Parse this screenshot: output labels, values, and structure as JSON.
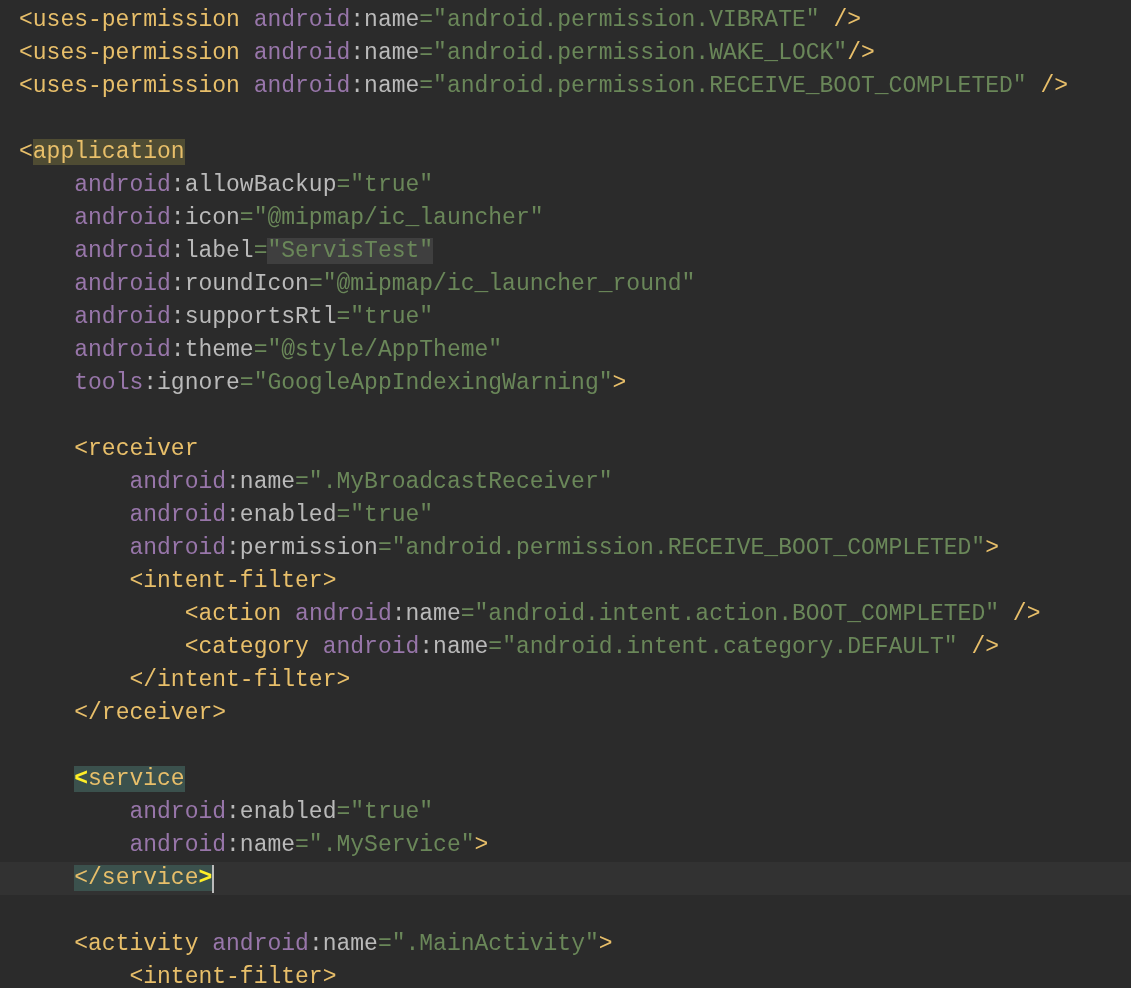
{
  "editor": {
    "lines": [
      {
        "kind": "code",
        "tokens": [
          {
            "kind": "tag",
            "text": "<uses-permission"
          },
          {
            "kind": "ns",
            "text": " android"
          },
          {
            "kind": "attr",
            "text": ":name"
          },
          {
            "kind": "value",
            "text": "=\"android.permission.VIBRATE\""
          },
          {
            "kind": "tag",
            "text": " />"
          }
        ]
      },
      {
        "kind": "code",
        "tokens": [
          {
            "kind": "tag",
            "text": "<uses-permission"
          },
          {
            "kind": "ns",
            "text": " android"
          },
          {
            "kind": "attr",
            "text": ":name"
          },
          {
            "kind": "value",
            "text": "=\"android.permission.WAKE_LOCK\""
          },
          {
            "kind": "tag",
            "text": "/>"
          }
        ]
      },
      {
        "kind": "code",
        "tokens": [
          {
            "kind": "tag",
            "text": "<uses-permission"
          },
          {
            "kind": "ns",
            "text": " android"
          },
          {
            "kind": "attr",
            "text": ":name"
          },
          {
            "kind": "value",
            "text": "=\"android.permission.RECEIVE_BOOT_COMPLETED\""
          },
          {
            "kind": "tag",
            "text": " />"
          }
        ]
      },
      {
        "kind": "blank"
      },
      {
        "kind": "code",
        "tokens": [
          {
            "kind": "tag",
            "text": "<"
          },
          {
            "kind": "tag",
            "text": "application",
            "tag_match": true
          }
        ]
      },
      {
        "kind": "code",
        "tokens": [
          {
            "kind": "ns",
            "text": "    android"
          },
          {
            "kind": "attr",
            "text": ":allowBackup"
          },
          {
            "kind": "value",
            "text": "=\"true\""
          }
        ]
      },
      {
        "kind": "code",
        "tokens": [
          {
            "kind": "ns",
            "text": "    android"
          },
          {
            "kind": "attr",
            "text": ":icon"
          },
          {
            "kind": "value",
            "text": "=\"@mipmap/ic_launcher\""
          }
        ]
      },
      {
        "kind": "code",
        "tokens": [
          {
            "kind": "ns",
            "text": "    android"
          },
          {
            "kind": "attr",
            "text": ":label"
          },
          {
            "kind": "value",
            "text": "="
          },
          {
            "kind": "value",
            "text": "\"ServisTest\"",
            "text_match": true
          }
        ]
      },
      {
        "kind": "code",
        "tokens": [
          {
            "kind": "ns",
            "text": "    android"
          },
          {
            "kind": "attr",
            "text": ":roundIcon"
          },
          {
            "kind": "value",
            "text": "=\"@mipmap/ic_launcher_round\""
          }
        ]
      },
      {
        "kind": "code",
        "tokens": [
          {
            "kind": "ns",
            "text": "    android"
          },
          {
            "kind": "attr",
            "text": ":supportsRtl"
          },
          {
            "kind": "value",
            "text": "=\"true\""
          }
        ]
      },
      {
        "kind": "code",
        "tokens": [
          {
            "kind": "ns",
            "text": "    android"
          },
          {
            "kind": "attr",
            "text": ":theme"
          },
          {
            "kind": "value",
            "text": "=\"@style/AppTheme\""
          }
        ]
      },
      {
        "kind": "code",
        "tokens": [
          {
            "kind": "ns",
            "text": "    tools"
          },
          {
            "kind": "attr",
            "text": ":ignore"
          },
          {
            "kind": "value",
            "text": "=\"GoogleAppIndexingWarning\""
          },
          {
            "kind": "tag",
            "text": ">"
          }
        ]
      },
      {
        "kind": "blank"
      },
      {
        "kind": "code",
        "tokens": [
          {
            "kind": "tag",
            "text": "    <receiver"
          }
        ]
      },
      {
        "kind": "code",
        "tokens": [
          {
            "kind": "ns",
            "text": "        android"
          },
          {
            "kind": "attr",
            "text": ":name"
          },
          {
            "kind": "value",
            "text": "=\".MyBroadcastReceiver\""
          }
        ]
      },
      {
        "kind": "code",
        "tokens": [
          {
            "kind": "ns",
            "text": "        android"
          },
          {
            "kind": "attr",
            "text": ":enabled"
          },
          {
            "kind": "value",
            "text": "=\"true\""
          }
        ]
      },
      {
        "kind": "code",
        "tokens": [
          {
            "kind": "ns",
            "text": "        android"
          },
          {
            "kind": "attr",
            "text": ":permission"
          },
          {
            "kind": "value",
            "text": "=\"android.permission.RECEIVE_BOOT_COMPLETED\""
          },
          {
            "kind": "tag",
            "text": ">"
          }
        ]
      },
      {
        "kind": "code",
        "tokens": [
          {
            "kind": "tag",
            "text": "        <intent-filter>"
          }
        ]
      },
      {
        "kind": "code",
        "tokens": [
          {
            "kind": "tag",
            "text": "            <action"
          },
          {
            "kind": "ns",
            "text": " android"
          },
          {
            "kind": "attr",
            "text": ":name"
          },
          {
            "kind": "value",
            "text": "=\"android.intent.action.BOOT_COMPLETED\""
          },
          {
            "kind": "tag",
            "text": " />"
          }
        ]
      },
      {
        "kind": "code",
        "tokens": [
          {
            "kind": "tag",
            "text": "            <category"
          },
          {
            "kind": "ns",
            "text": " android"
          },
          {
            "kind": "attr",
            "text": ":name"
          },
          {
            "kind": "value",
            "text": "=\"android.intent.category.DEFAULT\""
          },
          {
            "kind": "tag",
            "text": " />"
          }
        ]
      },
      {
        "kind": "code",
        "tokens": [
          {
            "kind": "tag",
            "text": "        </intent-filter>"
          }
        ]
      },
      {
        "kind": "code",
        "tokens": [
          {
            "kind": "tag",
            "text": "    </receiver>"
          }
        ]
      },
      {
        "kind": "blank"
      },
      {
        "kind": "code",
        "tokens": [
          {
            "kind": "brace",
            "text": "    <",
            "brace_match": true
          },
          {
            "kind": "tag",
            "text": "service",
            "brace_match": true
          }
        ]
      },
      {
        "kind": "code",
        "tokens": [
          {
            "kind": "ns",
            "text": "        android"
          },
          {
            "kind": "attr",
            "text": ":enabled"
          },
          {
            "kind": "value",
            "text": "=\"true\""
          }
        ]
      },
      {
        "kind": "code",
        "tokens": [
          {
            "kind": "ns",
            "text": "        android"
          },
          {
            "kind": "attr",
            "text": ":name"
          },
          {
            "kind": "value",
            "text": "=\".MyService\""
          },
          {
            "kind": "tag",
            "text": ">"
          }
        ]
      },
      {
        "kind": "code",
        "current": true,
        "caret": true,
        "tokens": [
          {
            "kind": "tag",
            "text": "    </service",
            "brace_match": true
          },
          {
            "kind": "brace",
            "text": ">",
            "brace_match": true
          }
        ]
      },
      {
        "kind": "blank"
      },
      {
        "kind": "code",
        "tokens": [
          {
            "kind": "tag",
            "text": "    <activity"
          },
          {
            "kind": "ns",
            "text": " android"
          },
          {
            "kind": "attr",
            "text": ":name"
          },
          {
            "kind": "value",
            "text": "=\".MainActivity\""
          },
          {
            "kind": "tag",
            "text": ">"
          }
        ]
      },
      {
        "kind": "code",
        "tokens": [
          {
            "kind": "tag",
            "text": "        <intent-filter>"
          }
        ]
      }
    ]
  }
}
